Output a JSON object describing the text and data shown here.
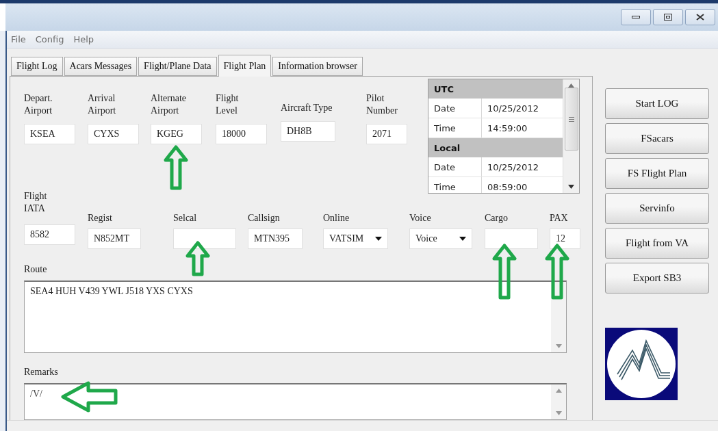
{
  "menu": [
    {
      "label": "File"
    },
    {
      "label": "Config"
    },
    {
      "label": "Help"
    }
  ],
  "tabs": [
    {
      "label": "Flight Log",
      "selected": false
    },
    {
      "label": "Acars Messages",
      "selected": false
    },
    {
      "label": "Flight/Plane Data",
      "selected": false
    },
    {
      "label": "Flight Plan",
      "selected": true
    },
    {
      "label": "Information browser",
      "selected": false
    }
  ],
  "row_1": [
    {
      "label": "Depart.\nAirport",
      "value": "KSEA",
      "kind": "text"
    },
    {
      "label": "Arrival\nAirport",
      "value": "CYXS",
      "kind": "text"
    },
    {
      "label": "Alternate\nAirport",
      "value": "KGEG",
      "kind": "text"
    },
    {
      "label": "Flight\nLevel",
      "value": "18000",
      "kind": "text"
    },
    {
      "label": "Aircraft Type",
      "value": "DH8B",
      "kind": "text"
    },
    {
      "label": "Pilot\nNumber",
      "value": "2071",
      "kind": "text"
    }
  ],
  "time_table": [
    {
      "title": "UTC",
      "rows": [
        {
          "label": "Date",
          "value": "10/25/2012"
        },
        {
          "label": "Time",
          "value": "14:59:00"
        }
      ]
    },
    {
      "title": "Local",
      "rows": [
        {
          "label": "Date",
          "value": "10/25/2012"
        },
        {
          "label": "Time",
          "value": "08:59:00"
        }
      ]
    }
  ],
  "row_2": [
    {
      "label": "Flight\nIATA",
      "value": "8582",
      "kind": "text"
    },
    {
      "label": "Regist",
      "value": "N852MT",
      "kind": "text"
    },
    {
      "label": "Selcal",
      "kind": "text"
    },
    {
      "label": "Callsign",
      "value": "MTN395",
      "kind": "text"
    },
    {
      "label": "Online",
      "value": "VATSIM",
      "kind": "dropdown"
    },
    {
      "label": "Voice",
      "value": "Voice",
      "kind": "dropdown"
    },
    {
      "label": "Cargo",
      "kind": "text"
    },
    {
      "label": "PAX",
      "value": "12",
      "kind": "text"
    }
  ],
  "route": {
    "label": "Route",
    "value": "SEA4 HUH V439 YWL J518 YXS CYXS"
  },
  "remarks": {
    "label": "Remarks",
    "value": "/V/"
  },
  "buttons": [
    "Start LOG",
    "FSacars",
    "FS Flight Plan",
    "Servinfo",
    "Flight from VA",
    "Export SB3"
  ]
}
